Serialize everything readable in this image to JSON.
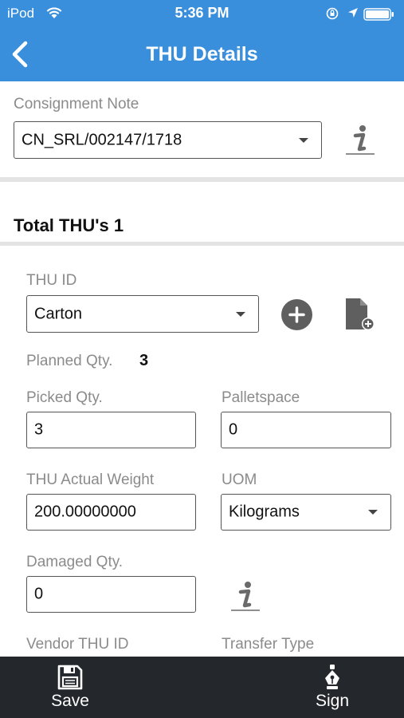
{
  "status_bar": {
    "carrier": "iPod",
    "time": "5:36 PM"
  },
  "nav": {
    "title": "THU Details"
  },
  "consignment": {
    "label": "Consignment Note",
    "value": "CN_SRL/002147/1718"
  },
  "summary": {
    "total_label": "Total THU's 1"
  },
  "thu": {
    "id_label": "THU ID",
    "id_value": "Carton",
    "planned_label": "Planned Qty.",
    "planned_value": "3",
    "picked_label": "Picked Qty.",
    "picked_value": "3",
    "palletspace_label": "Palletspace",
    "palletspace_value": "0",
    "weight_label": "THU Actual Weight",
    "weight_value": "200.00000000",
    "uom_label": "UOM",
    "uom_value": "Kilograms",
    "damaged_label": "Damaged Qty.",
    "damaged_value": "0",
    "vendor_label": "Vendor THU ID",
    "transfer_label": "Transfer Type"
  },
  "tabbar": {
    "save_label": "Save",
    "sign_label": "Sign"
  },
  "colors": {
    "header_blue": "#3a8fdc",
    "tabbar_dark": "#24282c",
    "icon_gray": "#6a6a6a"
  },
  "icons": [
    "wifi-icon",
    "orientation-lock-icon",
    "location-arrow-icon",
    "battery-icon",
    "back-chevron-icon",
    "info-icon",
    "add-circle-icon",
    "add-document-icon",
    "save-floppy-icon",
    "sign-pen-icon"
  ]
}
